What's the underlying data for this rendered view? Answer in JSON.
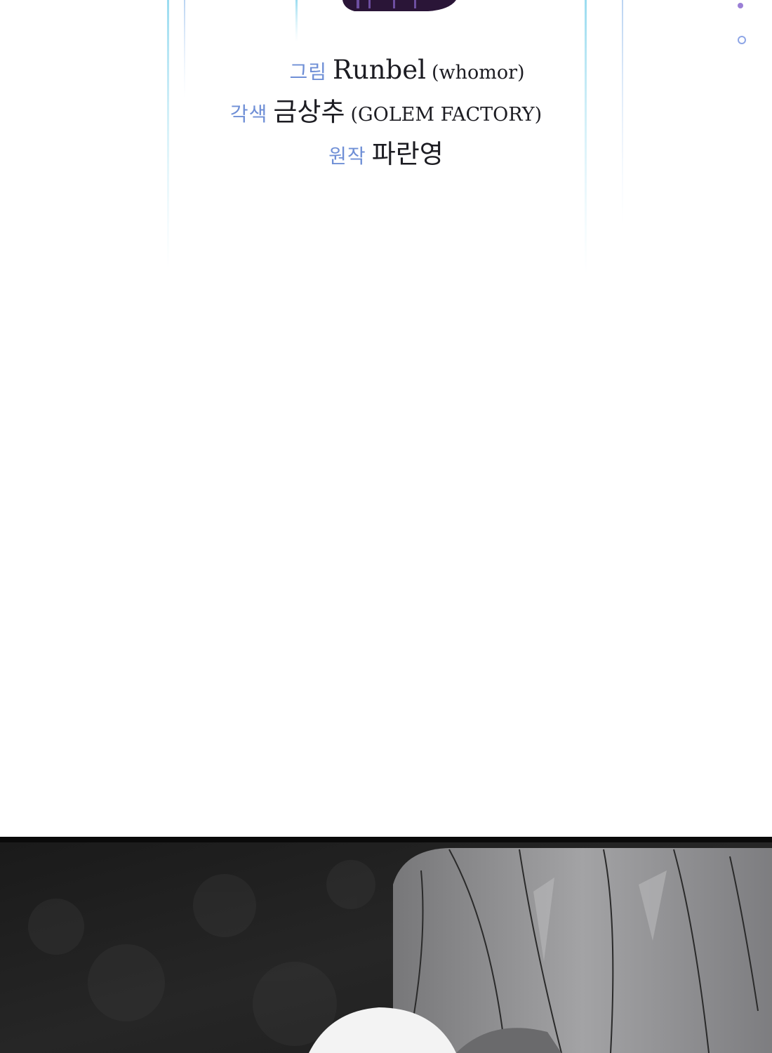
{
  "credits": [
    {
      "role": "그림",
      "name": "Runbel",
      "extra": "(whomor)"
    },
    {
      "role": "각색",
      "name": "금상추",
      "extra": "(GOLEM FACTORY)"
    },
    {
      "role": "원작",
      "name": "파란영",
      "extra": ""
    }
  ],
  "colors": {
    "role_text": "#6f8fd6",
    "name_text": "#1c1c22",
    "background": "#ffffff",
    "panel_dark": "#111111",
    "hair_gray": "#8e8e90",
    "title_purple": "#3a1f4e"
  },
  "art": {
    "top_title_art": "glowing-title-streaks",
    "bottom_panel": "dark-forest-gray-haired-character"
  }
}
